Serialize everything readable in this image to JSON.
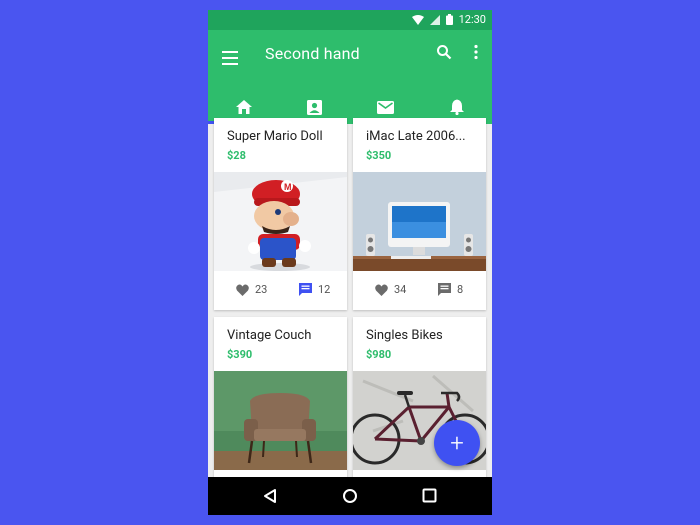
{
  "status": {
    "time": "12:30",
    "icons": [
      "wifi-icon",
      "signal-icon",
      "battery-icon"
    ]
  },
  "appbar": {
    "title": "Second hand",
    "menu_icon": "menu-icon",
    "search_icon": "search-icon",
    "more_icon": "more-vert-icon"
  },
  "tabs": [
    {
      "icon": "home-icon",
      "selected": true
    },
    {
      "icon": "contacts-icon",
      "selected": false
    },
    {
      "icon": "mail-icon",
      "selected": false
    },
    {
      "icon": "bell-icon",
      "selected": false
    }
  ],
  "items": [
    {
      "title": "Super Mario Doll",
      "price": "$28",
      "likes": "23",
      "comments": "12"
    },
    {
      "title": "iMac Late 2006...",
      "price": "$350",
      "likes": "34",
      "comments": "8"
    },
    {
      "title": "Vintage Couch",
      "price": "$390"
    },
    {
      "title": "Singles Bikes",
      "price": "$980"
    }
  ],
  "fab": {
    "label": "+"
  },
  "colors": {
    "primary": "#2ebd6c",
    "primary_dark": "#1fa45c",
    "accent": "#3f51f2",
    "background": "#4a55f0"
  },
  "navbar": {
    "icons": [
      "back-icon",
      "home-circle-icon",
      "recents-icon"
    ]
  }
}
